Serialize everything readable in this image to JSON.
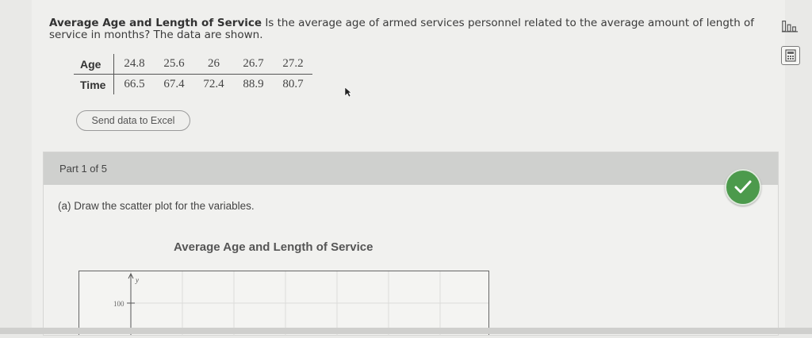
{
  "question": {
    "title": "Average Age and Length of Service",
    "text": "Is the average age of armed services personnel related to the average amount of length of service in months? The data are shown."
  },
  "side_icons": [
    "bar-chart-icon",
    "calculator-icon"
  ],
  "table": {
    "row_labels": [
      "Age",
      "Time"
    ],
    "age": [
      "24.8",
      "25.6",
      "26",
      "26.7",
      "27.2"
    ],
    "time": [
      "66.5",
      "67.4",
      "72.4",
      "88.9",
      "80.7"
    ]
  },
  "excel_button": "Send data to Excel",
  "part": {
    "label": "Part 1 of 5",
    "prompt": "(a) Draw the scatter plot for the variables."
  },
  "chart_data": {
    "type": "scatter",
    "title": "Average Age and Length of Service",
    "ylabel": "y",
    "y_ticks": [
      "100"
    ]
  },
  "colors": {
    "check_green": "#4c9a4c",
    "part_header": "#cfd0ce"
  }
}
